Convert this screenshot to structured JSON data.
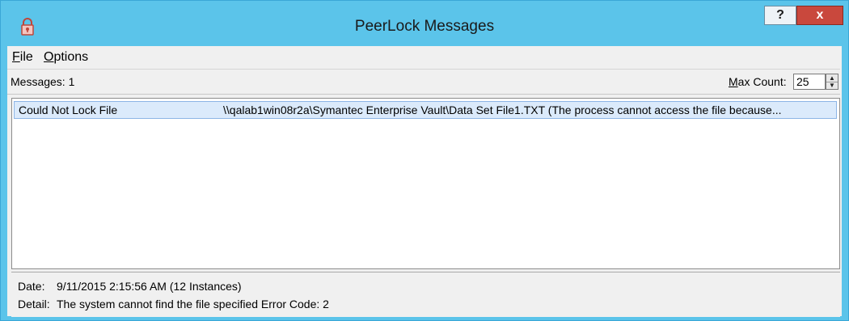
{
  "window": {
    "title": "PeerLock Messages",
    "help_label": "?",
    "close_label": "x"
  },
  "menu": [
    {
      "label": "File",
      "mnemonic": "F",
      "rest": "ile"
    },
    {
      "label": "Options",
      "mnemonic": "O",
      "rest": "ptions"
    }
  ],
  "toolbar": {
    "messages_label": "Messages: 1",
    "max_count_mnemonic": "M",
    "max_count_rest": "ax Count:",
    "max_count_value": "25"
  },
  "messages": [
    {
      "type": "Could Not Lock File",
      "path": "\\\\qalab1win08r2a\\Symantec Enterprise Vault\\Data Set File1.TXT (The process cannot access the file because..."
    }
  ],
  "details": {
    "date_label": "Date:",
    "date_value": "9/11/2015 2:15:56 AM   (12 Instances)",
    "detail_label": "Detail:",
    "detail_value": "The system cannot find the file specified Error Code: 2"
  },
  "colors": {
    "titlebar": "#5bc4ea",
    "close": "#c9483d",
    "selection": "#dbeafb"
  },
  "icons": {
    "app": "padlock-icon",
    "spin_up": "triangle-up",
    "spin_down": "triangle-down"
  }
}
